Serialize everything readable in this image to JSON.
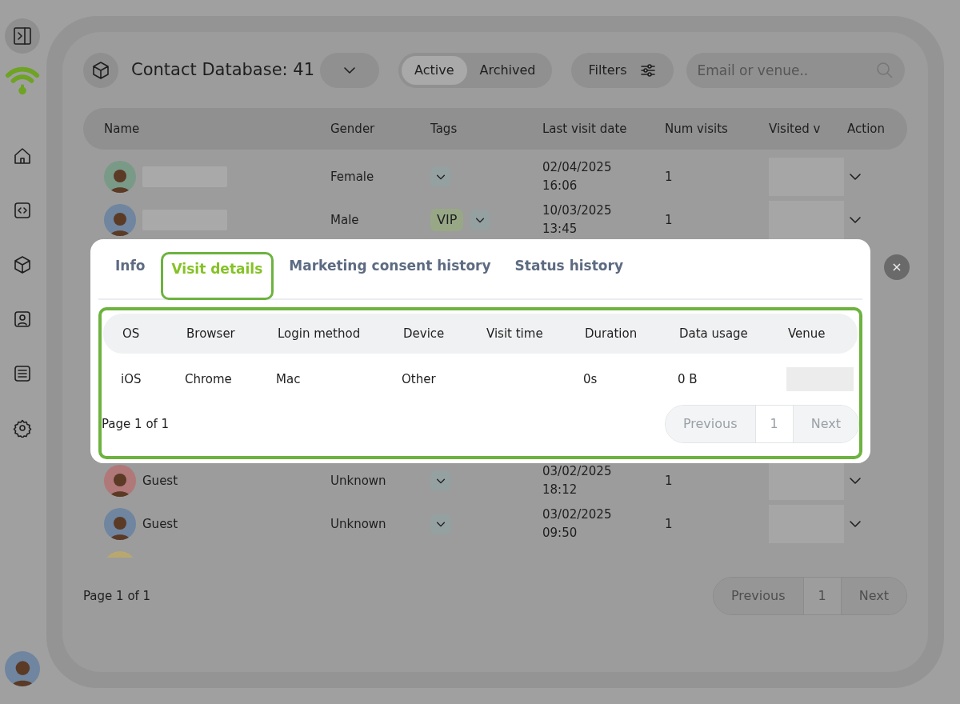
{
  "header": {
    "title": "Contact Database: 41",
    "segments": [
      {
        "label": "Active",
        "selected": true
      },
      {
        "label": "Archived",
        "selected": false
      }
    ],
    "filters_label": "Filters",
    "search": {
      "placeholder": "Email or venue.."
    }
  },
  "table": {
    "columns": [
      "Name",
      "Gender",
      "Tags",
      "Last visit date",
      "Num visits",
      "Visited v",
      "Action"
    ],
    "rows": [
      {
        "color": "#7a9a88",
        "name": "",
        "gender": "Female",
        "tags": [],
        "date": "02/04/2025",
        "time": "16:06",
        "visits": "1"
      },
      {
        "color": "#6f85a0",
        "name": "",
        "gender": "Male",
        "tags": [
          "VIP"
        ],
        "date": "10/03/2025",
        "time": "13:45",
        "visits": "1"
      },
      {
        "color": "#b07878",
        "name": "Guest",
        "gender": "Unknown",
        "tags": [],
        "date": "03/02/2025",
        "time": "18:12",
        "visits": "1"
      },
      {
        "color": "#6f85a0",
        "name": "Guest",
        "gender": "Unknown",
        "tags": [],
        "date": "03/02/2025",
        "time": "09:50",
        "visits": "1"
      }
    ]
  },
  "pagination": {
    "page_text": "Page 1 of 1",
    "previous": "Previous",
    "current": "1",
    "next": "Next"
  },
  "modal": {
    "tabs": [
      {
        "label": "Info",
        "selected": false
      },
      {
        "label": "Visit details",
        "selected": true
      },
      {
        "label": "Marketing consent history",
        "selected": false
      },
      {
        "label": "Status history",
        "selected": false
      }
    ],
    "columns": [
      "OS",
      "Browser",
      "Login method",
      "Device",
      "Visit time",
      "Duration",
      "Data usage",
      "Venue"
    ],
    "rows": [
      {
        "cells": [
          "iOS",
          "Chrome",
          "Mac",
          "Other",
          "",
          "0s",
          "0 B"
        ]
      }
    ],
    "pagination": {
      "page_text": "Page 1 of 1",
      "previous": "Previous",
      "current": "1",
      "next": "Next"
    },
    "close": "×"
  }
}
